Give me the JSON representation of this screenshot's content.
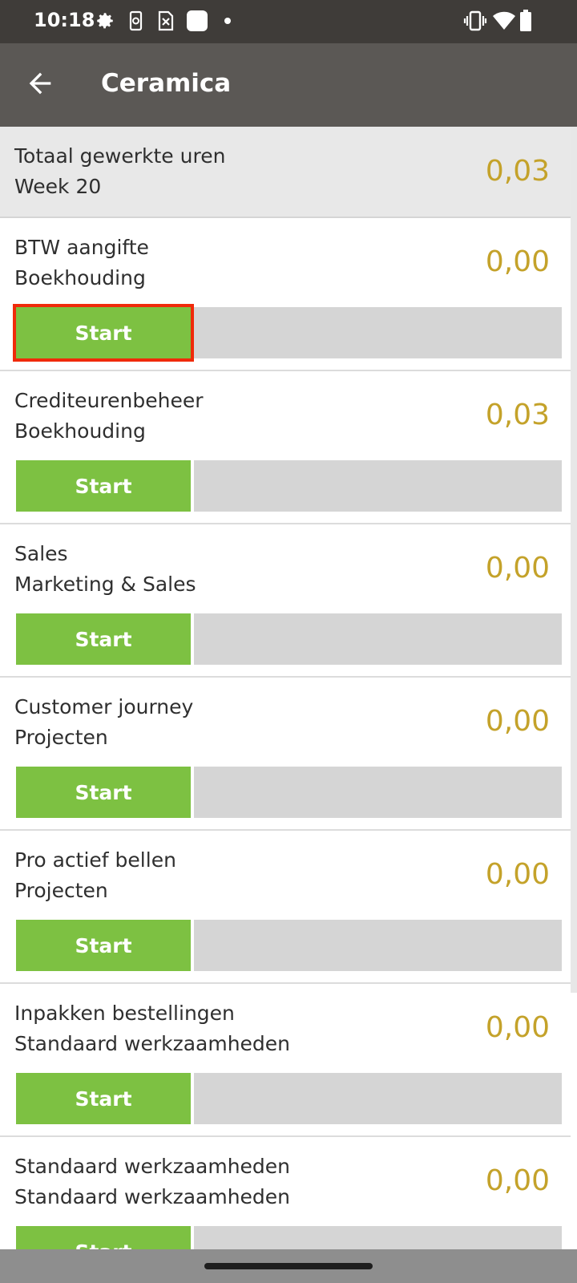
{
  "status_bar": {
    "time": "10:18",
    "icons": [
      "settings-gear",
      "phone-sync",
      "sim-x",
      "notification-square",
      "dot",
      "vibrate",
      "wifi",
      "battery"
    ]
  },
  "app_bar": {
    "title": "Ceramica",
    "back_icon": "arrow-left"
  },
  "summary": {
    "line1": "Totaal gewerkte uren",
    "line2": "Week 20",
    "value": "0,03"
  },
  "activities": [
    {
      "name": "BTW aangifte",
      "category": "Boekhouding",
      "value": "0,00",
      "button": "Start",
      "selected": true
    },
    {
      "name": "Crediteurenbeheer",
      "category": "Boekhouding",
      "value": "0,03",
      "button": "Start"
    },
    {
      "name": "Sales",
      "category": "Marketing & Sales",
      "value": "0,00",
      "button": "Start"
    },
    {
      "name": "Customer journey",
      "category": "Projecten",
      "value": "0,00",
      "button": "Start"
    },
    {
      "name": "Pro actief bellen",
      "category": "Projecten",
      "value": "0,00",
      "button": "Start"
    },
    {
      "name": "Inpakken bestellingen",
      "category": "Standaard werkzaamheden",
      "value": "0,00",
      "button": "Start"
    },
    {
      "name": "Standaard werkzaamheden",
      "category": "Standaard werkzaamheden",
      "value": "0,00",
      "button": "Start"
    }
  ],
  "colors": {
    "status_bar": "#3f3c39",
    "app_bar": "#5b5855",
    "value_gold": "#c4a22a",
    "start_green": "#7dc142",
    "selection_red": "#f02a0a"
  }
}
